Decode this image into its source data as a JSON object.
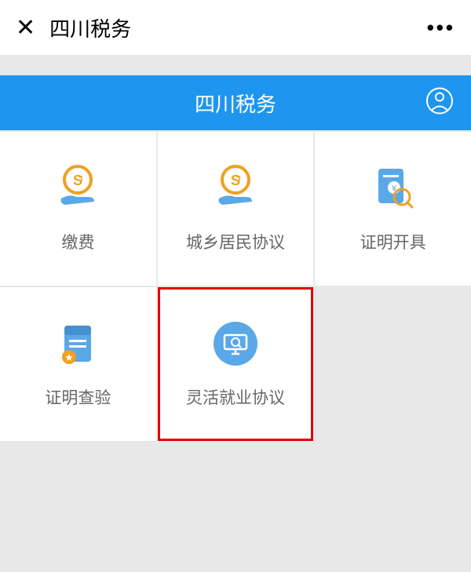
{
  "topbar": {
    "title": "四川税务"
  },
  "header": {
    "title": "四川税务"
  },
  "tiles": [
    {
      "label": "缴费",
      "icon": "pay-hand"
    },
    {
      "label": "城乡居民协议",
      "icon": "pay-hand"
    },
    {
      "label": "证明开具",
      "icon": "doc-search"
    },
    {
      "label": "证明查验",
      "icon": "doc-star"
    },
    {
      "label": "灵活就业协议",
      "icon": "circle-screen",
      "highlight": true
    }
  ],
  "colors": {
    "primary": "#1e96f0",
    "highlight": "#e60000",
    "icon_blue": "#5aa8e8",
    "icon_orange": "#f0a020"
  }
}
